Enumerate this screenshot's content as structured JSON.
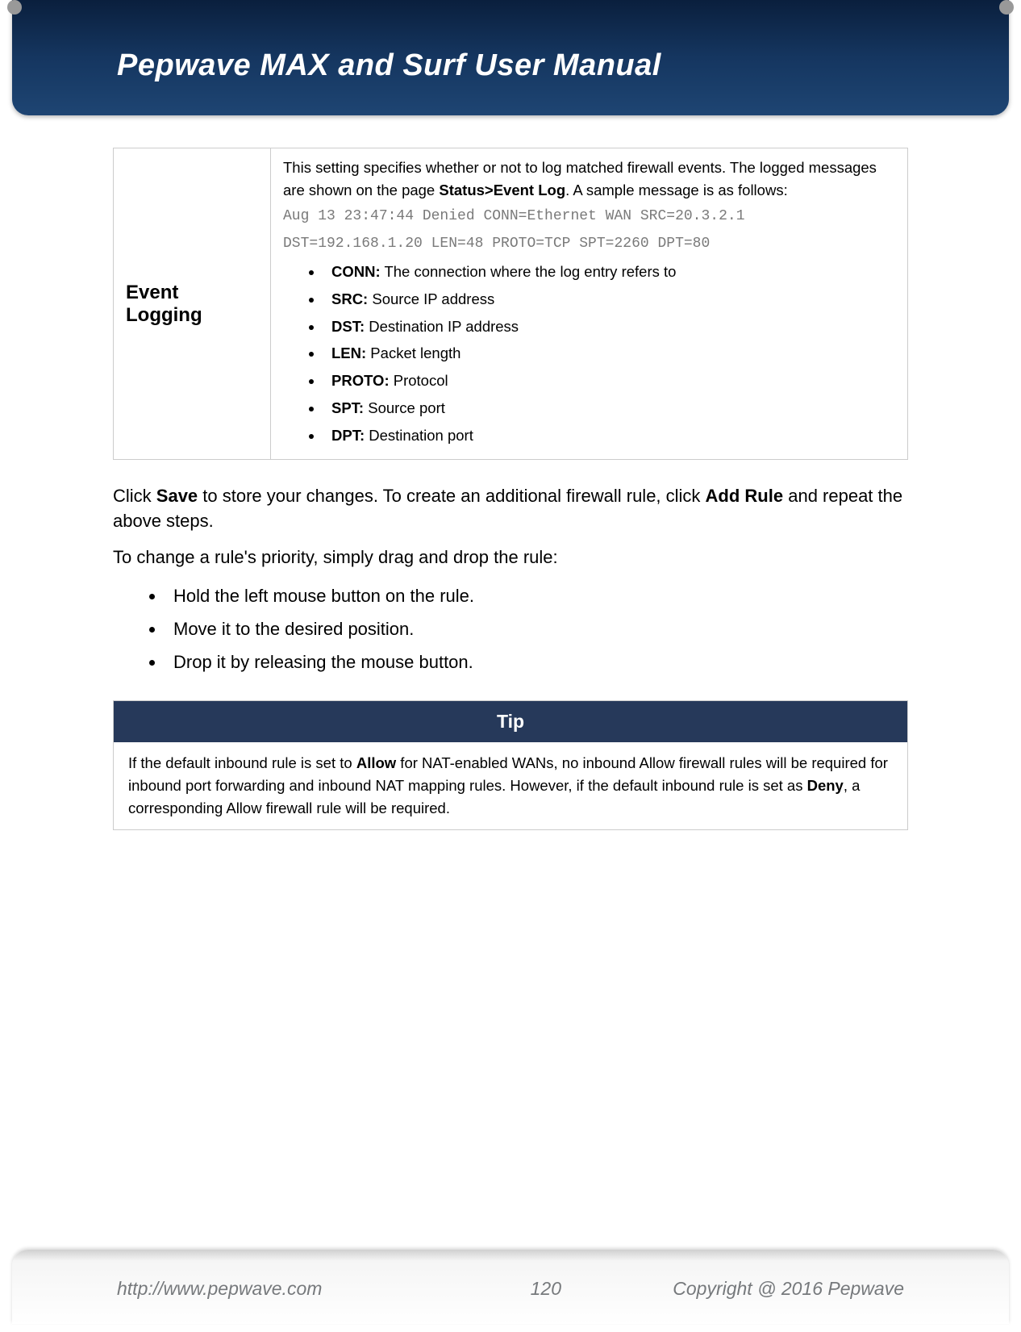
{
  "header": {
    "title": "Pepwave MAX and Surf User Manual"
  },
  "table": {
    "label": "Event Logging",
    "intro_pre": "This setting specifies whether or not to log matched firewall events. The logged messages are shown on the page ",
    "intro_bold": "Status>Event Log",
    "intro_post": ". A sample message is as follows:",
    "code_line1": "Aug 13 23:47:44 Denied CONN=Ethernet WAN SRC=20.3.2.1",
    "code_line2": "DST=192.168.1.20 LEN=48 PROTO=TCP SPT=2260 DPT=80",
    "defs": [
      {
        "term": "CONN:",
        "desc": "  The connection where the log entry refers to"
      },
      {
        "term": "SRC:",
        "desc": "  Source IP address"
      },
      {
        "term": "DST:",
        "desc": "  Destination IP address"
      },
      {
        "term": "LEN:",
        "desc": "  Packet length"
      },
      {
        "term": "PROTO:",
        "desc": "  Protocol"
      },
      {
        "term": "SPT:",
        "desc": "  Source port"
      },
      {
        "term": "DPT:",
        "desc": "  Destination port"
      }
    ]
  },
  "body": {
    "p1_a": "Click ",
    "p1_b1": "Save",
    "p1_b": " to store your changes. To create an additional firewall rule, click ",
    "p1_b2": "Add Rule",
    "p1_c": " and repeat the above steps.",
    "p2": "To change a rule's priority, simply drag and drop the rule:",
    "steps": [
      "Hold the left mouse button on the rule.",
      "Move it to the desired position.",
      "Drop it by releasing the mouse button."
    ]
  },
  "tip": {
    "header": "Tip",
    "a": "If the default inbound rule is set to ",
    "b1": "Allow",
    "b": " for NAT-enabled WANs, no inbound Allow firewall rules will be required for inbound port forwarding and inbound NAT mapping rules. However, if the default inbound rule is set as ",
    "b2": "Deny",
    "c": ", a corresponding Allow firewall rule will be required."
  },
  "footer": {
    "url": "http://www.pepwave.com",
    "page": "120",
    "copyright": "Copyright @ 2016 Pepwave"
  }
}
